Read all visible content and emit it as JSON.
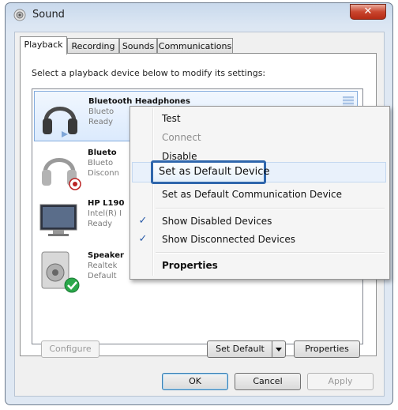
{
  "window": {
    "title": "Sound",
    "close_glyph": "✕"
  },
  "tabs": [
    {
      "label": "Playback"
    },
    {
      "label": "Recording"
    },
    {
      "label": "Sounds"
    },
    {
      "label": "Communications"
    }
  ],
  "instructions": "Select a playback device below to modify its settings:",
  "devices": [
    {
      "name": "Bluetooth Headphones",
      "line2": "Blueto",
      "line3": "Ready",
      "icon": "headphones-icon"
    },
    {
      "name": "Blueto",
      "line2": "Blueto",
      "line3": "Disconn",
      "icon": "headphones-disconnected-icon"
    },
    {
      "name": "HP L190",
      "line2": "Intel(R) I",
      "line3": "Ready",
      "icon": "monitor-icon"
    },
    {
      "name": "Speaker",
      "line2": "Realtek",
      "line3": "Default",
      "icon": "speaker-default-icon"
    }
  ],
  "buttons": {
    "configure": "Configure",
    "set_default": "Set Default",
    "properties": "Properties",
    "ok": "OK",
    "cancel": "Cancel",
    "apply": "Apply"
  },
  "context_menu": {
    "items": [
      {
        "label": "Test"
      },
      {
        "label": "Connect"
      },
      {
        "label": "Disable"
      },
      {
        "label": "Set as Default Device"
      },
      {
        "label": "Set as Default Communication Device"
      },
      {
        "label": "Show Disabled Devices"
      },
      {
        "label": "Show Disconnected Devices"
      },
      {
        "label": "Properties"
      }
    ],
    "check_glyph": "✓"
  }
}
